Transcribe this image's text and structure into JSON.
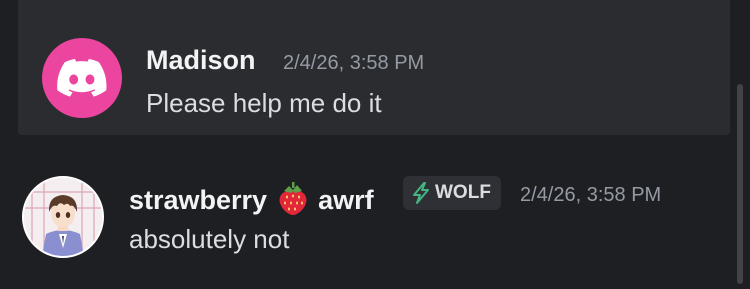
{
  "messages": [
    {
      "author": "Madison",
      "timestamp": "2/4/26, 3:58 PM",
      "content": "Please help me do it",
      "avatar_icon": "discord-logo-icon",
      "avatar_color": "#eb459f",
      "highlighted": true
    },
    {
      "author_part1": "strawberry",
      "author_emoji": "strawberry-emoji-icon",
      "author_part2": "awrf",
      "tag_label": "WOLF",
      "tag_icon": "lightning-icon",
      "timestamp": "2/4/26, 3:58 PM",
      "content": "absolutely not",
      "avatar_icon": "anime-character-avatar"
    }
  ],
  "colors": {
    "background": "#1e1f22",
    "highlight": "#2b2c30",
    "username": "#f2f3f5",
    "timestamp": "#949ba4",
    "message_text": "#dbdee1",
    "tag_icon": "#43b581"
  }
}
